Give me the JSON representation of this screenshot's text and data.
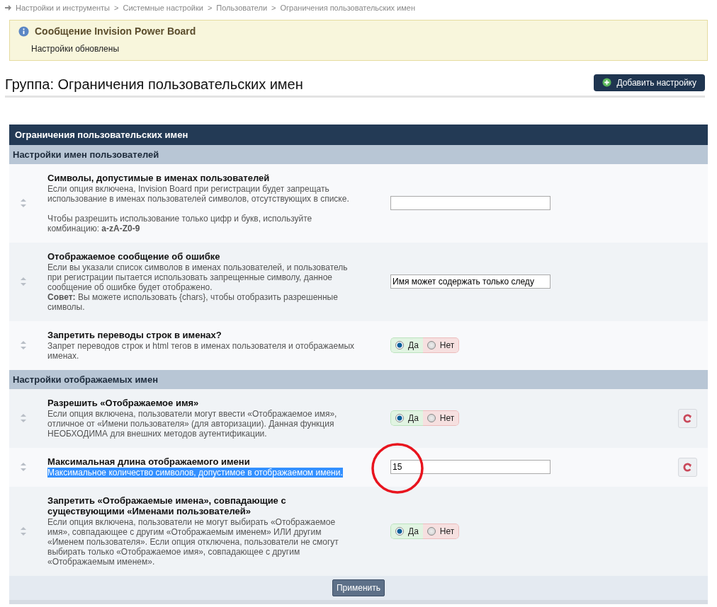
{
  "breadcrumb": [
    "Настройки и инструменты",
    "Системные настройки",
    "Пользователи",
    "Ограничения пользовательских имен"
  ],
  "breadcrumb_separator": ">",
  "message": {
    "title": "Сообщение Invision Power Board",
    "text": "Настройки обновлены"
  },
  "page_title": "Группа: Ограничения пользовательских имен",
  "add_button": "Добавить настройку",
  "table": {
    "title": "Ограничения пользовательских имен",
    "sections": [
      {
        "title": "Настройки имен пользователей",
        "rows": [
          {
            "kind": "text",
            "title": "Символы, допустимые в именах пользователей",
            "description": [
              "Если опция включена, Invision Board при регистрации будет запрещать использование в именах пользователей символов, отсутствующих в списке.",
              "Чтобы разрешить использование только цифр и букв, используйте комбинацию: **a-zA-Z0-9**"
            ],
            "highlighted": false,
            "value": "",
            "revert": false
          },
          {
            "kind": "text",
            "title": "Отображаемое сообщение об ошибке",
            "description": [
              "Если вы указали список символов в именах пользователей, и пользователь при регистрации пытается использовать запрещенные символу, данное сообщение об ошибке будет отображено.\n**Совет:** Вы можете использовать {chars}, чтобы отобразить разрешенные символы."
            ],
            "highlighted": false,
            "value": "Имя может содержать только следу",
            "revert": false
          },
          {
            "kind": "yesno",
            "title": "Запретить переводы строк в именах?",
            "description": [
              "Запрет переводов строк и html тегов в именах пользователя и отображаемых именах."
            ],
            "highlighted": false,
            "options": [
              {
                "label": "Да",
                "selected": true
              },
              {
                "label": "Нет",
                "selected": false
              }
            ],
            "revert": false
          }
        ]
      },
      {
        "title": "Настройки отображаемых имен",
        "rows": [
          {
            "kind": "yesno",
            "title": "Разрешить «Отображаемое имя»",
            "description": [
              "Если опция включена, пользователи могут ввести «Отображаемое имя», отличное от «Имени пользователя» (для авторизации). Данная функция НЕОБХОДИМА для внешних методов аутентификации."
            ],
            "highlighted": false,
            "options": [
              {
                "label": "Да",
                "selected": true
              },
              {
                "label": "Нет",
                "selected": false
              }
            ],
            "revert": true
          },
          {
            "kind": "text",
            "title": "Максимальная длина отображаемого имени",
            "description": [
              "Максимальное количество символов, допустимое в отображаемом имени."
            ],
            "highlighted": true,
            "value": "15",
            "revert": true,
            "circled": true
          },
          {
            "kind": "yesno",
            "title": "Запретить «Отображаемые имена», совпадающие с существующими «Именами пользователей»",
            "description": [
              "Если опция включена, пользователи не могут выбирать «Отображаемое имя», совпадающее с другим «Отображаемым именем» ИЛИ другим «Именем пользователя». Если опция отключена, пользователи не смогут выбирать только «Отображаемое имя», совпадающее с другим «Отображаемым именем»."
            ],
            "highlighted": false,
            "options": [
              {
                "label": "Да",
                "selected": true
              },
              {
                "label": "Нет",
                "selected": false
              }
            ],
            "revert": false
          }
        ]
      }
    ],
    "submit": "Применить"
  }
}
